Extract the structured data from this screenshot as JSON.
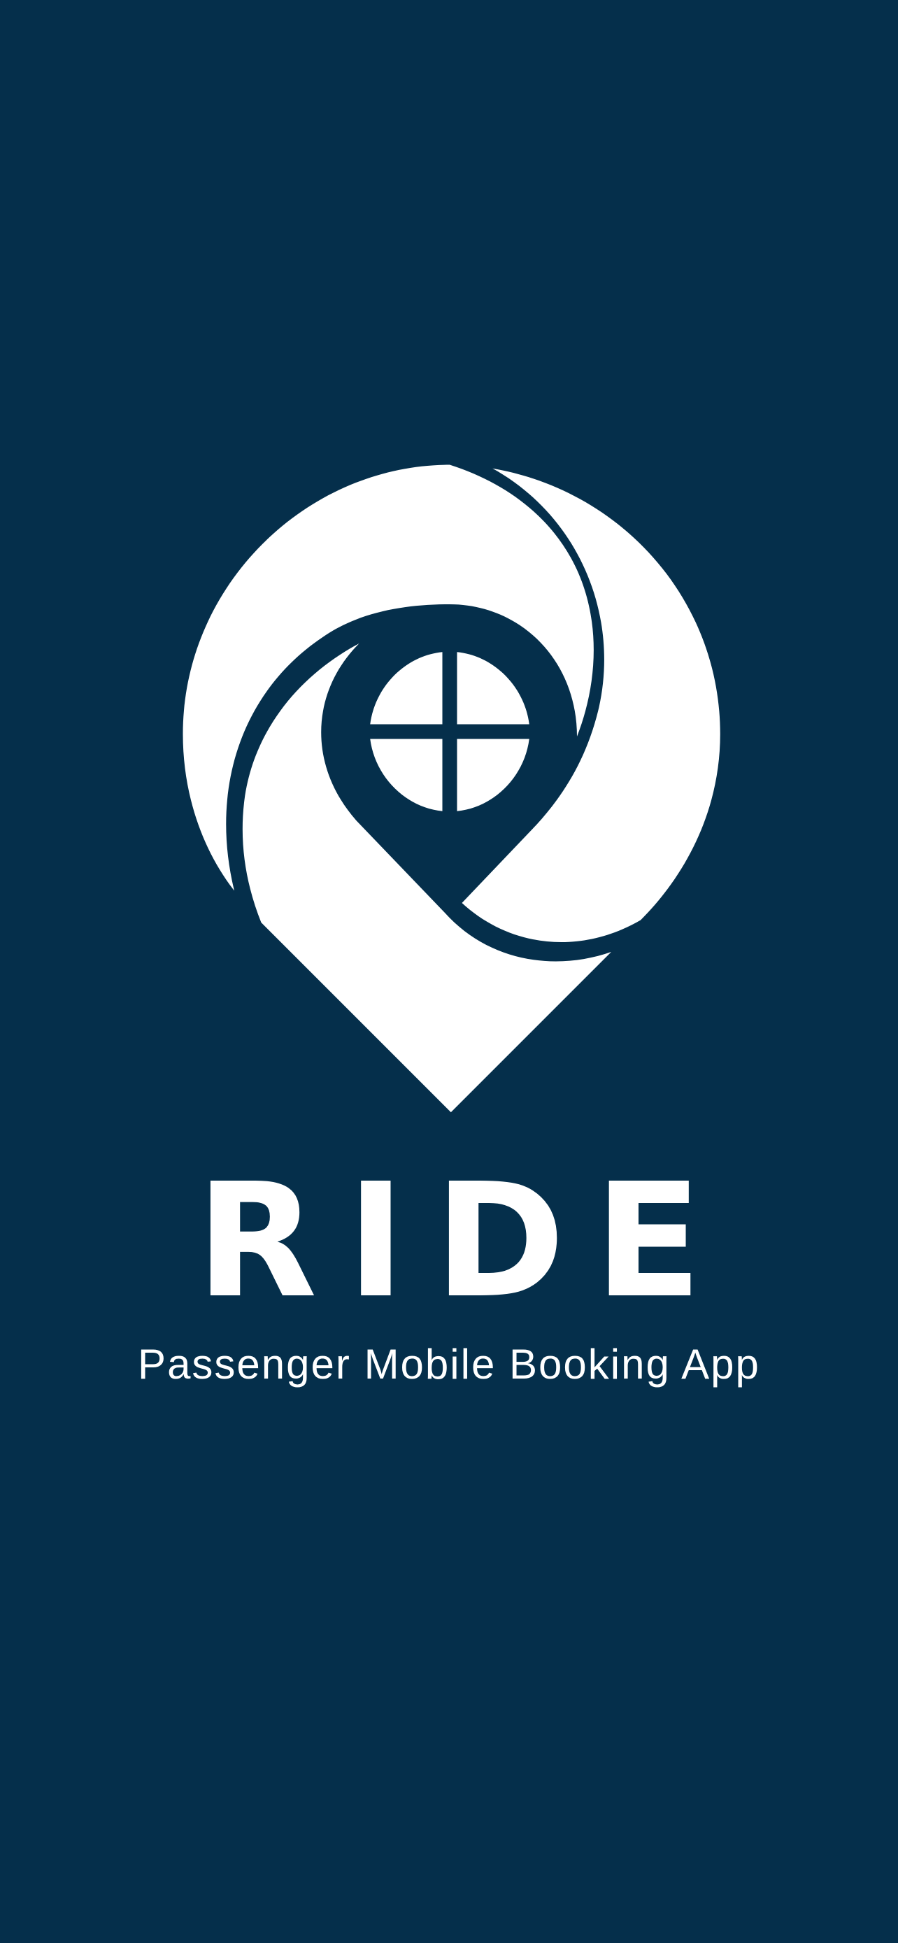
{
  "screen": {
    "background_color": "#052f4b",
    "foreground_color": "#ffffff"
  },
  "logo": {
    "icon": "map-pin-camera-shutter-icon"
  },
  "app_name": "RIDE",
  "tagline": "Passenger Mobile Booking App"
}
